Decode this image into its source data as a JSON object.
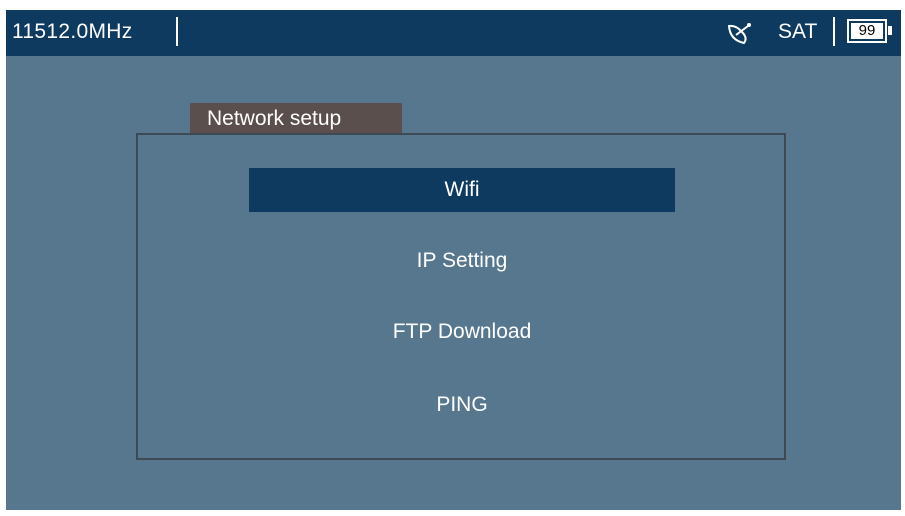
{
  "status_bar": {
    "frequency": "11512.0MHz",
    "signal_type": "SAT",
    "battery_level": "99",
    "dish_icon": "satellite-dish-icon",
    "battery_icon": "battery-icon"
  },
  "panel": {
    "title": "Network setup",
    "items": [
      {
        "label": "Wifi",
        "selected": true
      },
      {
        "label": "IP Setting",
        "selected": false
      },
      {
        "label": "FTP Download",
        "selected": false
      },
      {
        "label": "PING",
        "selected": false
      }
    ]
  },
  "colors": {
    "background": "#57778e",
    "bar": "#0f3a5f",
    "tab": "#5a4f4c",
    "highlight": "#0f3a5f"
  }
}
